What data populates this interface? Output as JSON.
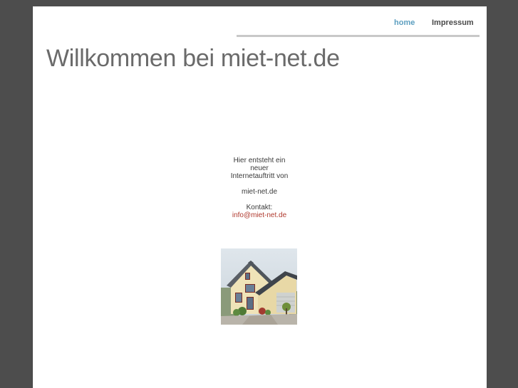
{
  "nav": {
    "home_label": "home",
    "impressum_label": "Impressum"
  },
  "page": {
    "title": "Willkommen bei miet-net.de"
  },
  "content": {
    "line1": "Hier entsteht ein",
    "line2": "neuer",
    "line3": "Internetauftritt von",
    "site": "miet-net.de",
    "contact_label": "Kontakt:",
    "email": "info@miet-net.de"
  },
  "image": {
    "icon": "house-photo"
  }
}
